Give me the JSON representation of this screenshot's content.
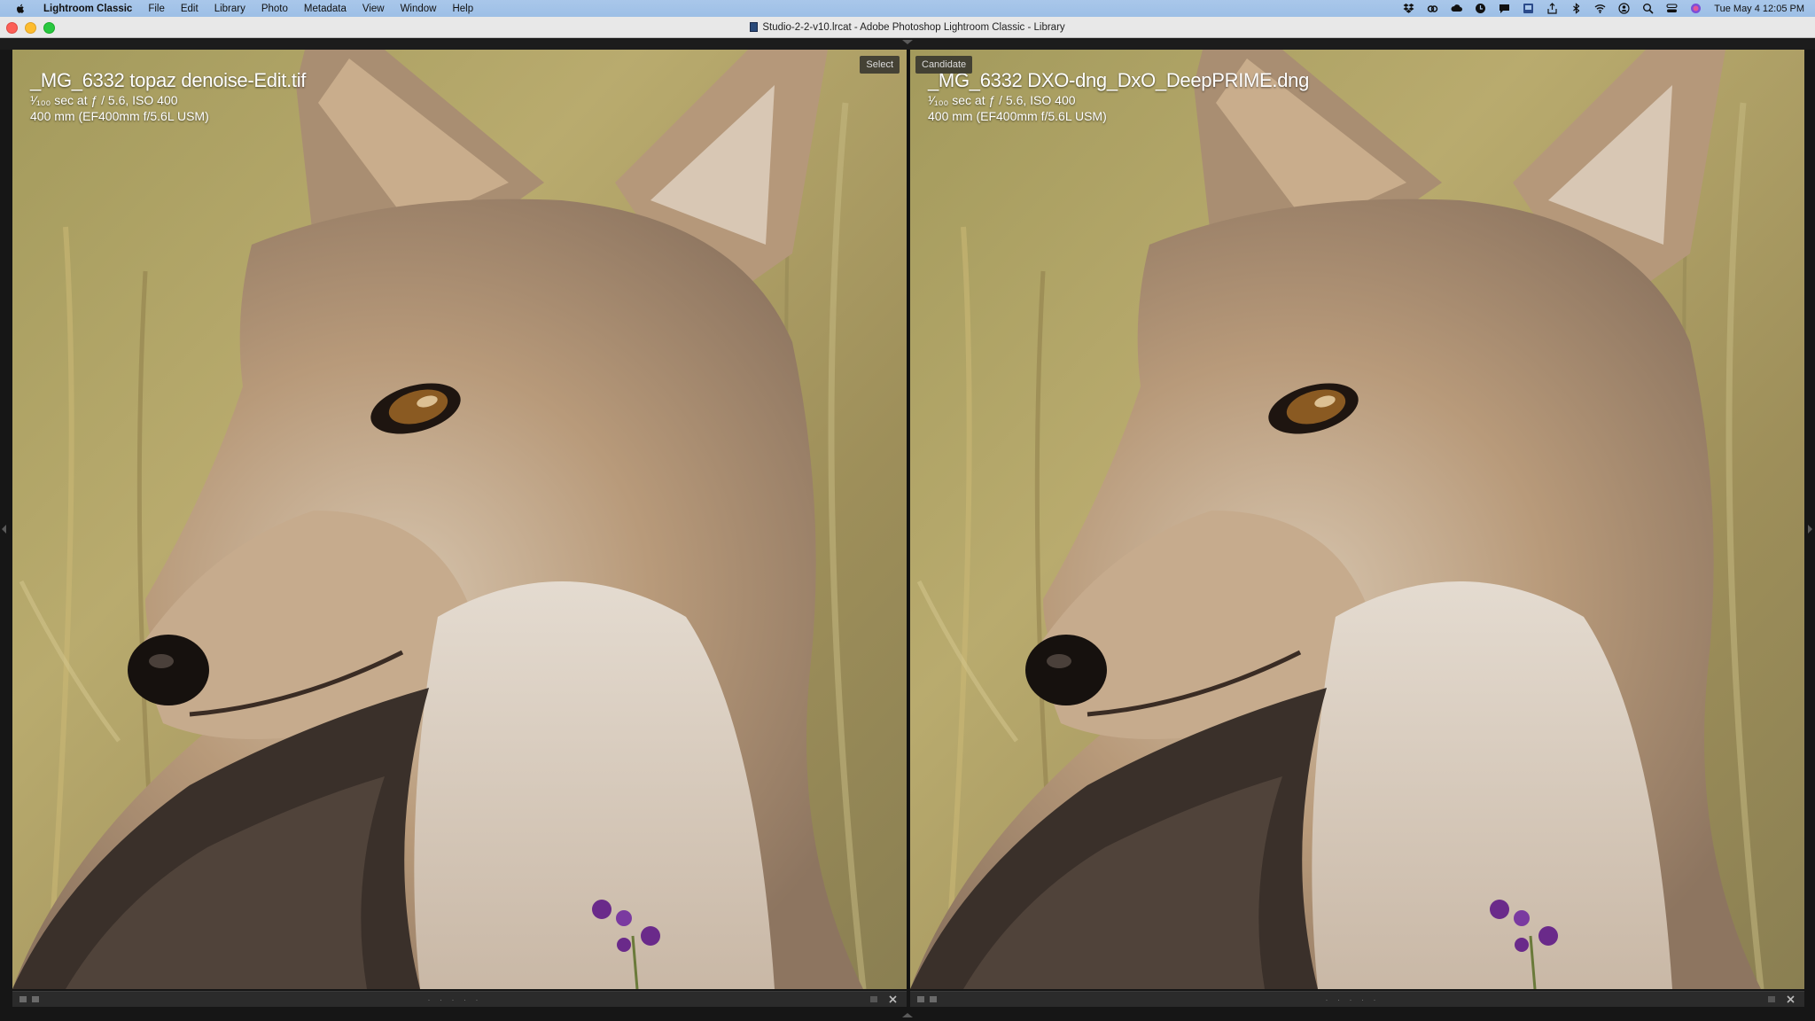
{
  "menubar": {
    "app_name": "Lightroom Classic",
    "items": [
      "File",
      "Edit",
      "Library",
      "Photo",
      "Metadata",
      "View",
      "Window",
      "Help"
    ],
    "clock": "Tue May 4  12:05 PM",
    "status_icons": [
      "dropbox-icon",
      "creative-cloud-icon",
      "cloud-icon",
      "clock-icon",
      "chat-icon",
      "screen-icon",
      "share-icon",
      "bluetooth-icon",
      "wifi-icon",
      "user-icon",
      "search-icon",
      "control-center-icon",
      "siri-icon"
    ]
  },
  "window": {
    "title": "Studio-2-2-v10.lrcat - Adobe Photoshop Lightroom Classic - Library"
  },
  "compare": {
    "select": {
      "tag": "Select",
      "filename": "_MG_6332 topaz denoise-Edit.tif",
      "exposure_line": "¹⁄₁₀₀ sec at ƒ / 5.6, ISO 400",
      "lens_line": "400 mm (EF400mm f/5.6L USM)"
    },
    "candidate": {
      "tag": "Candidate",
      "filename": "_MG_6332 DXO-dng_DxO_DeepPRIME.dng",
      "exposure_line": "¹⁄₁₀₀ sec at ƒ / 5.6, ISO 400",
      "lens_line": "400 mm (EF400mm f/5.6L USM)"
    }
  },
  "toolbar": {
    "dots": "· · · · ·"
  },
  "colors": {
    "menubar": "#a9c7ea",
    "titlebar": "#e8e8e8",
    "background": "#161616",
    "fur": "#b89a7a",
    "grass": "#9a9658"
  }
}
